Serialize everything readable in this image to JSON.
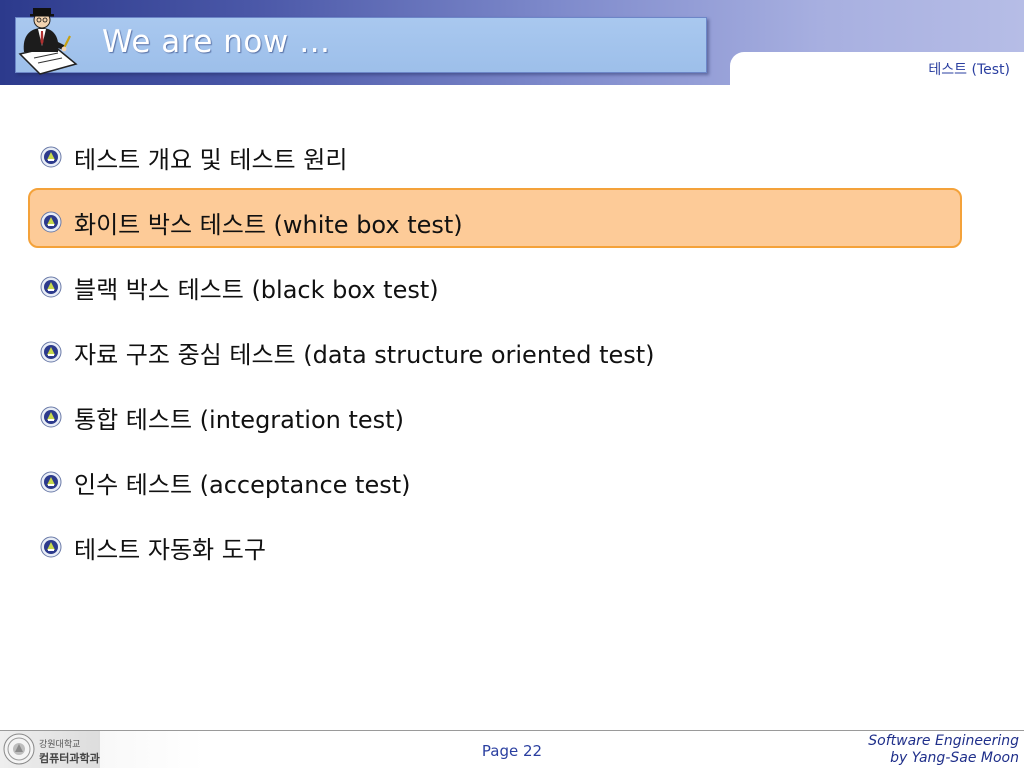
{
  "header": {
    "title": "We are now …",
    "section": "테스트 (Test)"
  },
  "content": {
    "highlighted_index": 1,
    "items": [
      {
        "label": "테스트 개요 및 테스트 원리"
      },
      {
        "label": "화이트 박스 테스트 (white box test)"
      },
      {
        "label": "블랙 박스 테스트 (black box test)"
      },
      {
        "label": "자료 구조 중심 테스트 (data structure oriented test)"
      },
      {
        "label": "통합 테스트 (integration test)"
      },
      {
        "label": "인수 테스트 (acceptance test)"
      },
      {
        "label": "테스트 자동화 도구"
      }
    ]
  },
  "footer": {
    "org_line1": "강원대학교",
    "org_line2": "컴퓨터과학과",
    "page": "Page 22",
    "course": "Software Engineering",
    "author": "by Yang-Sae Moon"
  },
  "colors": {
    "header_dark": "#2c3a8c",
    "title_box": "#a9c8ef",
    "highlight_fill": "#fdcb98",
    "highlight_border": "#f4a23a",
    "footer_text": "#2a3fa0"
  },
  "icons": {
    "clipart": "businessman-writing-icon",
    "bullet": "university-emblem-bullet-icon",
    "footer_logo": "university-seal-icon"
  }
}
